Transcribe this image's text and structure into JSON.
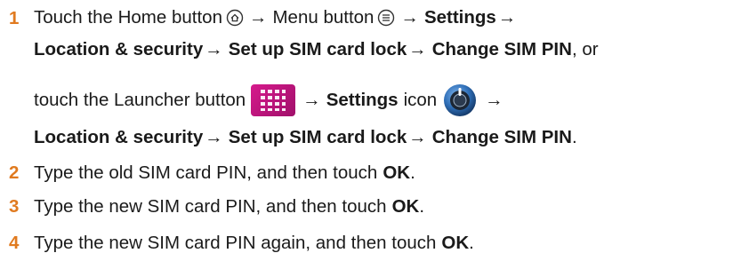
{
  "steps": [
    {
      "number": "1",
      "lines": {
        "l1": {
          "t1": "Touch the Home button",
          "t2": "Menu button",
          "t3": "Settings"
        },
        "l2": {
          "t1": "Location & security",
          "t2": "Set up SIM card lock",
          "t3": "Change SIM PIN",
          "t4": ", or"
        },
        "l3": {
          "t1": "touch the Launcher button",
          "t2": "Settings",
          "t3": "icon"
        },
        "l4": {
          "t1": "Location & security",
          "t2": "Set up SIM card lock",
          "t3": "Change SIM PIN",
          "t4": "."
        }
      }
    },
    {
      "number": "2",
      "text": "Type the old SIM card PIN, and then touch",
      "bold": "OK",
      "end": "."
    },
    {
      "number": "3",
      "text": "Type the new SIM card PIN, and then touch",
      "bold": "OK",
      "end": "."
    },
    {
      "number": "4",
      "text": "Type the new SIM card PIN again, and then touch",
      "bold": "OK",
      "end": "."
    }
  ],
  "arrow": "→",
  "colors": {
    "step_number": "#e07a1f",
    "launcher_icon": "#c2147c",
    "settings_icon": "#2f6fb8"
  },
  "icons": {
    "home": "home-icon",
    "menu": "menu-icon",
    "launcher": "launcher-icon",
    "settings": "settings-icon"
  }
}
